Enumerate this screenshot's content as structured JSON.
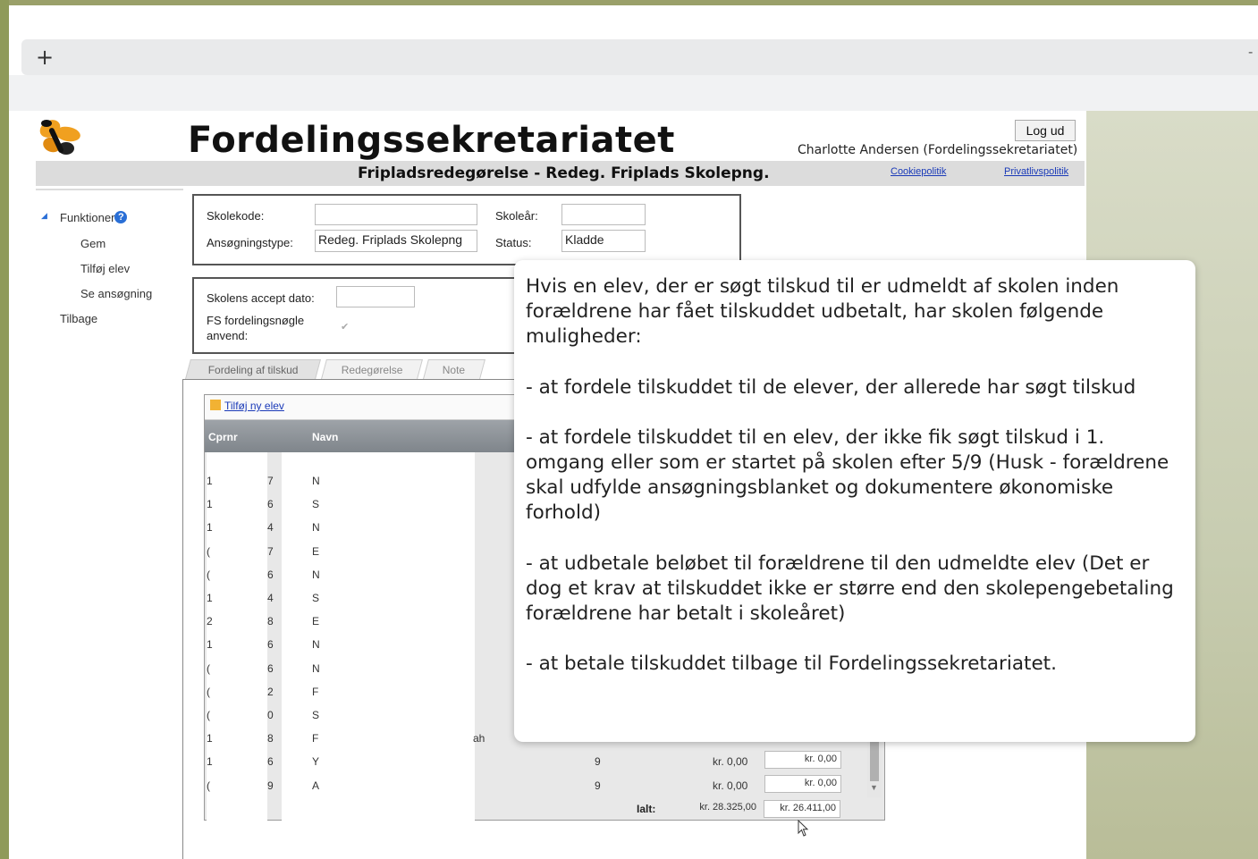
{
  "browser": {
    "new_tab_label": "+",
    "window_control": "-"
  },
  "header": {
    "title": "Fordelingssekretariatet",
    "subtitle": "Fripladsredegørelse - Redeg. Friplads Skolepng.",
    "logout_label": "Log ud",
    "user": "Charlotte Andersen (Fordelingssekretariatet)",
    "cookie_link": "Cookiepolitik",
    "privacy_link": "Privatlivspolitik"
  },
  "sidebar": {
    "heading": "Funktioner",
    "items": [
      "Gem",
      "Tilføj elev",
      "Se ansøgning"
    ],
    "back": "Tilbage"
  },
  "form": {
    "skolekode_label": "Skolekode:",
    "skolekode_value": "",
    "skoleaar_label": "Skoleår:",
    "skoleaar_value": "",
    "ansoegningstype_label": "Ansøgningstype:",
    "ansoegningstype_value": "Redeg. Friplads Skolepng",
    "status_label": "Status:",
    "status_value": "Kladde",
    "accept_label": "Skolens accept dato:",
    "accept_value": "",
    "fs_label_1": "FS fordelingsnøgle",
    "fs_label_2": "anvend:",
    "fs_checked": "✔"
  },
  "tabs": [
    "Fordeling af tilskud",
    "Redegørelse",
    "Note"
  ],
  "grid": {
    "add_link": "Tilføj ny elev",
    "columns": [
      "Cprnr",
      "Navn"
    ],
    "rows": [
      {
        "c1": "1",
        "c2": "7",
        "c3": "N",
        "extra": "",
        "n": "",
        "amount": "",
        "amount2": ""
      },
      {
        "c1": "1",
        "c2": "6",
        "c3": "S",
        "extra": "",
        "n": "",
        "amount": "",
        "amount2": ""
      },
      {
        "c1": "1",
        "c2": "4",
        "c3": "N",
        "extra": "",
        "n": "",
        "amount": "",
        "amount2": ""
      },
      {
        "c1": "(",
        "c2": "7",
        "c3": "E",
        "extra": "",
        "n": "",
        "amount": "",
        "amount2": ""
      },
      {
        "c1": "(",
        "c2": "6",
        "c3": "N",
        "extra": "",
        "n": "",
        "amount": "",
        "amount2": ""
      },
      {
        "c1": "1",
        "c2": "4",
        "c3": "S",
        "extra": "",
        "n": "",
        "amount": "",
        "amount2": ""
      },
      {
        "c1": "2",
        "c2": "8",
        "c3": "E",
        "extra": "",
        "n": "",
        "amount": "",
        "amount2": ""
      },
      {
        "c1": "1",
        "c2": "6",
        "c3": "N",
        "extra": "",
        "n": "",
        "amount": "",
        "amount2": ""
      },
      {
        "c1": "(",
        "c2": "6",
        "c3": "N",
        "extra": "",
        "n": "",
        "amount": "",
        "amount2": ""
      },
      {
        "c1": "(",
        "c2": "2",
        "c3": "F",
        "extra": "",
        "n": "",
        "amount": "",
        "amount2": ""
      },
      {
        "c1": "(",
        "c2": "0",
        "c3": "S",
        "extra": "",
        "n": "",
        "amount": "",
        "amount2": ""
      },
      {
        "c1": "1",
        "c2": "8",
        "c3": "F",
        "extra": "ah",
        "n": "",
        "amount": "",
        "amount2": ""
      },
      {
        "c1": "1",
        "c2": "6",
        "c3": "Y",
        "extra": "",
        "n": "9",
        "amount": "kr. 0,00",
        "amount2": "kr. 0,00"
      },
      {
        "c1": "(",
        "c2": "9",
        "c3": "A",
        "extra": "",
        "n": "9",
        "amount": "kr. 0,00",
        "amount2": "kr. 0,00"
      }
    ],
    "total_label": "Ialt:",
    "total_1": "kr. 28.325,00",
    "total_2": "kr. 26.411,00"
  },
  "popup": {
    "paragraphs": [
      "Hvis en elev, der er søgt tilskud til er udmeldt af skolen inden forældrene har fået tilskuddet udbetalt, har skolen følgende muligheder:",
      "- at fordele tilskuddet til de elever, der allerede har søgt tilskud",
      "- at fordele tilskuddet til en elev, der ikke fik søgt tilskud i 1. omgang eller som er startet på skolen efter 5/9 (Husk - forældrene skal udfylde ansøgningsblanket og dokumentere økonomiske forhold)",
      "- at udbetale beløbet til forældrene til den udmeldte elev (Det er dog et krav at tilskuddet ikke er større end den skolepengebetaling forældrene har betalt i skoleåret)",
      "- at betale tilskuddet tilbage til Fordelingssekretariatet."
    ]
  },
  "colors": {
    "accent": "#1a3ab8",
    "olive": "#9aa06a",
    "header_gray": "#dcdcdc"
  }
}
